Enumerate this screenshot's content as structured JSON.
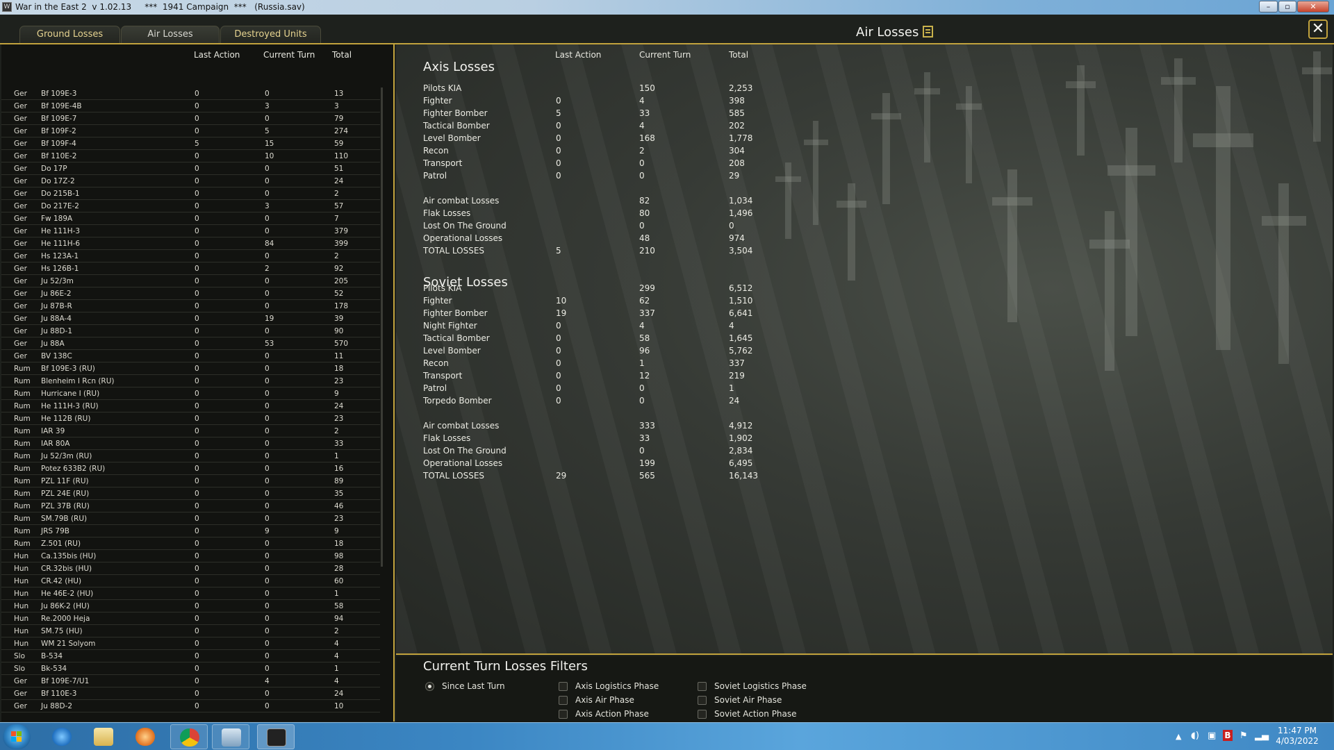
{
  "window": {
    "title": "War in the East 2  v 1.02.13     ***  1941 Campaign  ***   (Russia.sav)",
    "app_icon": "W"
  },
  "tabs": [
    {
      "label": "Ground Losses"
    },
    {
      "label": "Air Losses"
    },
    {
      "label": "Destroyed Units"
    }
  ],
  "panel": {
    "title": "Air Losses",
    "close": "✕"
  },
  "left": {
    "headers": {
      "last_action": "Last Action",
      "current_turn": "Current Turn",
      "total": "Total"
    },
    "rows": [
      {
        "nat": "Ger",
        "type": "Bf 109E-3",
        "la": "0",
        "ct": "0",
        "tot": "13"
      },
      {
        "nat": "Ger",
        "type": "Bf 109E-4B",
        "la": "0",
        "ct": "3",
        "tot": "3"
      },
      {
        "nat": "Ger",
        "type": "Bf 109E-7",
        "la": "0",
        "ct": "0",
        "tot": "79"
      },
      {
        "nat": "Ger",
        "type": "Bf 109F-2",
        "la": "0",
        "ct": "5",
        "tot": "274"
      },
      {
        "nat": "Ger",
        "type": "Bf 109F-4",
        "la": "5",
        "ct": "15",
        "tot": "59"
      },
      {
        "nat": "Ger",
        "type": "Bf 110E-2",
        "la": "0",
        "ct": "10",
        "tot": "110"
      },
      {
        "nat": "Ger",
        "type": "Do 17P",
        "la": "0",
        "ct": "0",
        "tot": "51"
      },
      {
        "nat": "Ger",
        "type": "Do 17Z-2",
        "la": "0",
        "ct": "0",
        "tot": "24"
      },
      {
        "nat": "Ger",
        "type": "Do 215B-1",
        "la": "0",
        "ct": "0",
        "tot": "2"
      },
      {
        "nat": "Ger",
        "type": "Do 217E-2",
        "la": "0",
        "ct": "3",
        "tot": "57"
      },
      {
        "nat": "Ger",
        "type": "Fw 189A",
        "la": "0",
        "ct": "0",
        "tot": "7"
      },
      {
        "nat": "Ger",
        "type": "He 111H-3",
        "la": "0",
        "ct": "0",
        "tot": "379"
      },
      {
        "nat": "Ger",
        "type": "He 111H-6",
        "la": "0",
        "ct": "84",
        "tot": "399"
      },
      {
        "nat": "Ger",
        "type": "Hs 123A-1",
        "la": "0",
        "ct": "0",
        "tot": "2"
      },
      {
        "nat": "Ger",
        "type": "Hs 126B-1",
        "la": "0",
        "ct": "2",
        "tot": "92"
      },
      {
        "nat": "Ger",
        "type": "Ju 52/3m",
        "la": "0",
        "ct": "0",
        "tot": "205"
      },
      {
        "nat": "Ger",
        "type": "Ju 86E-2",
        "la": "0",
        "ct": "0",
        "tot": "52"
      },
      {
        "nat": "Ger",
        "type": "Ju 87B-R",
        "la": "0",
        "ct": "0",
        "tot": "178"
      },
      {
        "nat": "Ger",
        "type": "Ju 88A-4",
        "la": "0",
        "ct": "19",
        "tot": "39"
      },
      {
        "nat": "Ger",
        "type": "Ju 88D-1",
        "la": "0",
        "ct": "0",
        "tot": "90"
      },
      {
        "nat": "Ger",
        "type": "Ju 88A",
        "la": "0",
        "ct": "53",
        "tot": "570"
      },
      {
        "nat": "Ger",
        "type": "BV 138C",
        "la": "0",
        "ct": "0",
        "tot": "11"
      },
      {
        "nat": "Rum",
        "type": "Bf 109E-3 (RU)",
        "la": "0",
        "ct": "0",
        "tot": "18"
      },
      {
        "nat": "Rum",
        "type": "Blenheim I Rcn (RU)",
        "la": "0",
        "ct": "0",
        "tot": "23"
      },
      {
        "nat": "Rum",
        "type": "Hurricane I (RU)",
        "la": "0",
        "ct": "0",
        "tot": "9"
      },
      {
        "nat": "Rum",
        "type": "He 111H-3 (RU)",
        "la": "0",
        "ct": "0",
        "tot": "24"
      },
      {
        "nat": "Rum",
        "type": "He 112B (RU)",
        "la": "0",
        "ct": "0",
        "tot": "23"
      },
      {
        "nat": "Rum",
        "type": "IAR 39",
        "la": "0",
        "ct": "0",
        "tot": "2"
      },
      {
        "nat": "Rum",
        "type": "IAR 80A",
        "la": "0",
        "ct": "0",
        "tot": "33"
      },
      {
        "nat": "Rum",
        "type": "Ju 52/3m (RU)",
        "la": "0",
        "ct": "0",
        "tot": "1"
      },
      {
        "nat": "Rum",
        "type": "Potez 633B2 (RU)",
        "la": "0",
        "ct": "0",
        "tot": "16"
      },
      {
        "nat": "Rum",
        "type": "PZL 11F (RU)",
        "la": "0",
        "ct": "0",
        "tot": "89"
      },
      {
        "nat": "Rum",
        "type": "PZL 24E (RU)",
        "la": "0",
        "ct": "0",
        "tot": "35"
      },
      {
        "nat": "Rum",
        "type": "PZL 37B (RU)",
        "la": "0",
        "ct": "0",
        "tot": "46"
      },
      {
        "nat": "Rum",
        "type": "SM.79B (RU)",
        "la": "0",
        "ct": "0",
        "tot": "23"
      },
      {
        "nat": "Rum",
        "type": "JRS 79B",
        "la": "0",
        "ct": "9",
        "tot": "9"
      },
      {
        "nat": "Rum",
        "type": "Z.501 (RU)",
        "la": "0",
        "ct": "0",
        "tot": "18"
      },
      {
        "nat": "Hun",
        "type": "Ca.135bis (HU)",
        "la": "0",
        "ct": "0",
        "tot": "98"
      },
      {
        "nat": "Hun",
        "type": "CR.32bis (HU)",
        "la": "0",
        "ct": "0",
        "tot": "28"
      },
      {
        "nat": "Hun",
        "type": "CR.42 (HU)",
        "la": "0",
        "ct": "0",
        "tot": "60"
      },
      {
        "nat": "Hun",
        "type": "He 46E-2 (HU)",
        "la": "0",
        "ct": "0",
        "tot": "1"
      },
      {
        "nat": "Hun",
        "type": "Ju 86K-2 (HU)",
        "la": "0",
        "ct": "0",
        "tot": "58"
      },
      {
        "nat": "Hun",
        "type": "Re.2000 Heja",
        "la": "0",
        "ct": "0",
        "tot": "94"
      },
      {
        "nat": "Hun",
        "type": "SM.75 (HU)",
        "la": "0",
        "ct": "0",
        "tot": "2"
      },
      {
        "nat": "Hun",
        "type": "WM 21 Solyom",
        "la": "0",
        "ct": "0",
        "tot": "4"
      },
      {
        "nat": "Slo",
        "type": "B-534",
        "la": "0",
        "ct": "0",
        "tot": "4"
      },
      {
        "nat": "Slo",
        "type": "Bk-534",
        "la": "0",
        "ct": "0",
        "tot": "1"
      },
      {
        "nat": "Ger",
        "type": "Bf 109E-7/U1",
        "la": "0",
        "ct": "4",
        "tot": "4"
      },
      {
        "nat": "Ger",
        "type": "Bf 110E-3",
        "la": "0",
        "ct": "0",
        "tot": "24"
      },
      {
        "nat": "Ger",
        "type": "Ju 88D-2",
        "la": "0",
        "ct": "0",
        "tot": "10"
      }
    ]
  },
  "right": {
    "headers": {
      "last_action": "Last Action",
      "current_turn": "Current Turn",
      "total": "Total"
    },
    "axis": {
      "title": "Axis Losses",
      "rows": [
        {
          "label": "Pilots KIA",
          "la": "",
          "ct": "150",
          "tot": "2,253"
        },
        {
          "label": "Fighter",
          "la": "0",
          "ct": "4",
          "tot": "398"
        },
        {
          "label": "Fighter Bomber",
          "la": "5",
          "ct": "33",
          "tot": "585"
        },
        {
          "label": "Tactical Bomber",
          "la": "0",
          "ct": "4",
          "tot": "202"
        },
        {
          "label": "Level Bomber",
          "la": "0",
          "ct": "168",
          "tot": "1,778"
        },
        {
          "label": "Recon",
          "la": "0",
          "ct": "2",
          "tot": "304"
        },
        {
          "label": "Transport",
          "la": "0",
          "ct": "0",
          "tot": "208"
        },
        {
          "label": "Patrol",
          "la": "0",
          "ct": "0",
          "tot": "29"
        }
      ],
      "summary": [
        {
          "label": "Air combat Losses",
          "la": "",
          "ct": "82",
          "tot": "1,034"
        },
        {
          "label": "Flak Losses",
          "la": "",
          "ct": "80",
          "tot": "1,496"
        },
        {
          "label": "Lost On The Ground",
          "la": "",
          "ct": "0",
          "tot": "0"
        },
        {
          "label": "Operational Losses",
          "la": "",
          "ct": "48",
          "tot": "974"
        },
        {
          "label": "TOTAL LOSSES",
          "la": "5",
          "ct": "210",
          "tot": "3,504"
        }
      ]
    },
    "soviet": {
      "title": "Soviet Losses",
      "rows": [
        {
          "label": "Pilots KIA",
          "la": "",
          "ct": "299",
          "tot": "6,512"
        },
        {
          "label": "Fighter",
          "la": "10",
          "ct": "62",
          "tot": "1,510"
        },
        {
          "label": "Fighter Bomber",
          "la": "19",
          "ct": "337",
          "tot": "6,641"
        },
        {
          "label": "Night Fighter",
          "la": "0",
          "ct": "4",
          "tot": "4"
        },
        {
          "label": "Tactical Bomber",
          "la": "0",
          "ct": "58",
          "tot": "1,645"
        },
        {
          "label": "Level Bomber",
          "la": "0",
          "ct": "96",
          "tot": "5,762"
        },
        {
          "label": "Recon",
          "la": "0",
          "ct": "1",
          "tot": "337"
        },
        {
          "label": "Transport",
          "la": "0",
          "ct": "12",
          "tot": "219"
        },
        {
          "label": "Patrol",
          "la": "0",
          "ct": "0",
          "tot": "1"
        },
        {
          "label": "Torpedo Bomber",
          "la": "0",
          "ct": "0",
          "tot": "24"
        }
      ],
      "summary": [
        {
          "label": "Air combat Losses",
          "la": "",
          "ct": "333",
          "tot": "4,912"
        },
        {
          "label": "Flak Losses",
          "la": "",
          "ct": "33",
          "tot": "1,902"
        },
        {
          "label": "Lost On The Ground",
          "la": "",
          "ct": "0",
          "tot": "2,834"
        },
        {
          "label": "Operational Losses",
          "la": "",
          "ct": "199",
          "tot": "6,495"
        },
        {
          "label": "TOTAL LOSSES",
          "la": "29",
          "ct": "565",
          "tot": "16,143"
        }
      ]
    }
  },
  "filters": {
    "title": "Current Turn Losses Filters",
    "options": [
      {
        "label": "Since Last Turn",
        "kind": "radio",
        "checked": true
      },
      {
        "label": "Axis Logistics Phase",
        "kind": "checkbox",
        "checked": false
      },
      {
        "label": "Axis Air Phase",
        "kind": "checkbox",
        "checked": false
      },
      {
        "label": "Axis Action Phase",
        "kind": "checkbox",
        "checked": false
      },
      {
        "label": "Soviet Logistics Phase",
        "kind": "checkbox",
        "checked": false
      },
      {
        "label": "Soviet Air Phase",
        "kind": "checkbox",
        "checked": false
      },
      {
        "label": "Soviet Action Phase",
        "kind": "checkbox",
        "checked": false
      }
    ]
  },
  "taskbar": {
    "clock_time": "11:47 PM",
    "clock_date": "4/03/2022",
    "apps": [
      "internet-explorer-icon",
      "file-explorer-icon",
      "media-player-icon",
      "chrome-icon",
      "window-switcher-icon",
      "war-in-the-east-icon"
    ]
  },
  "colors": {
    "accent_gold": "#c2a33d",
    "tab_text": "#e6d390"
  }
}
